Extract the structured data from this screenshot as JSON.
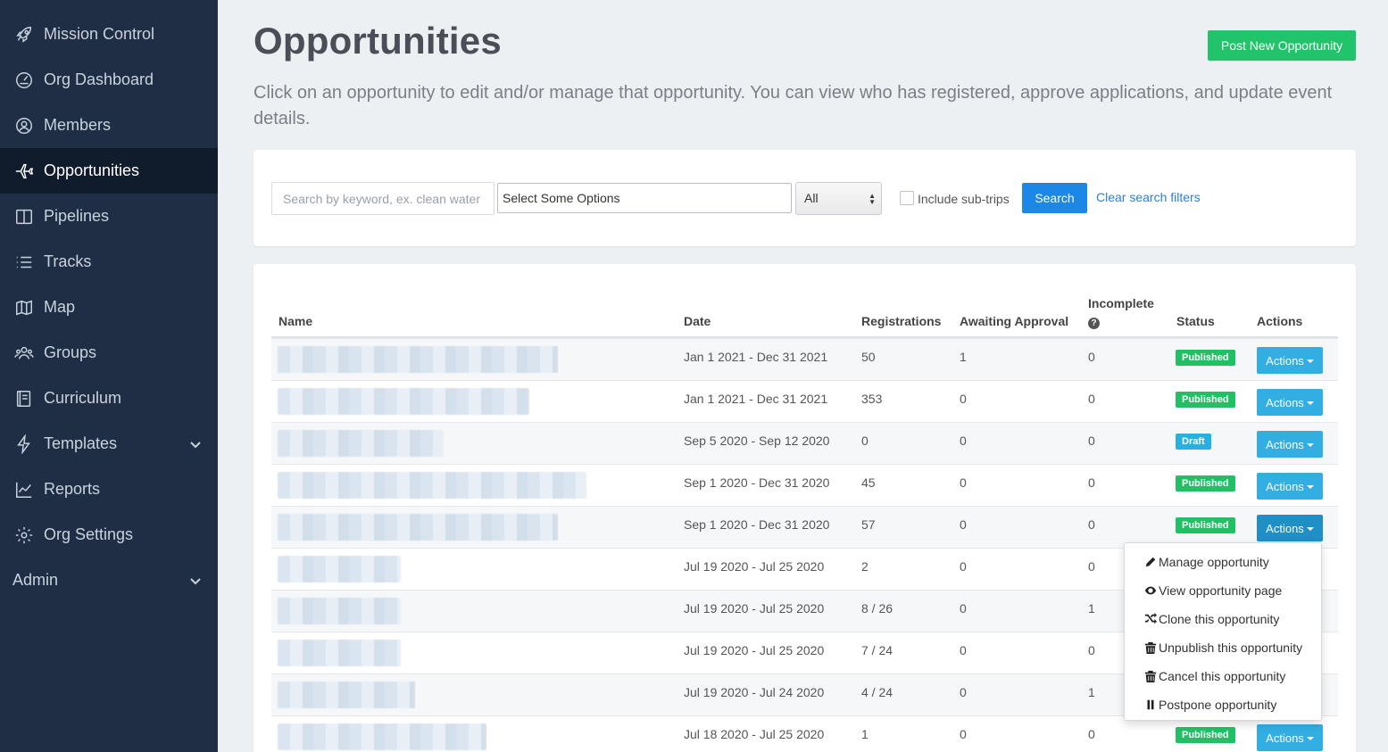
{
  "sidebar": {
    "items": [
      {
        "label": "Mission Control",
        "icon": "rocket-icon"
      },
      {
        "label": "Org Dashboard",
        "icon": "gauge-icon"
      },
      {
        "label": "Members",
        "icon": "user-circle-icon"
      },
      {
        "label": "Opportunities",
        "icon": "plane-icon",
        "active": true
      },
      {
        "label": "Pipelines",
        "icon": "columns-icon"
      },
      {
        "label": "Tracks",
        "icon": "list-icon"
      },
      {
        "label": "Map",
        "icon": "map-icon"
      },
      {
        "label": "Groups",
        "icon": "users-icon"
      },
      {
        "label": "Curriculum",
        "icon": "book-icon"
      },
      {
        "label": "Templates",
        "icon": "bolt-icon",
        "has_chevron": true
      },
      {
        "label": "Reports",
        "icon": "chart-line-icon"
      },
      {
        "label": "Org Settings",
        "icon": "gear-icon"
      }
    ],
    "admin": {
      "label": "Admin",
      "has_chevron": true
    }
  },
  "header": {
    "title": "Opportunities",
    "post_button": "Post New Opportunity",
    "intro": "Click on an opportunity to edit and/or manage that opportunity. You can view who has registered, approve applications, and update event details."
  },
  "filters": {
    "search_placeholder": "Search by keyword, ex. clean water",
    "multi_select": "Select Some Options",
    "status_select": "All",
    "include_subtrips": "Include sub-trips",
    "search_button": "Search",
    "clear_link": "Clear search filters"
  },
  "table": {
    "headers": {
      "name": "Name",
      "date": "Date",
      "registrations": "Registrations",
      "awaiting": "Awaiting Approval",
      "incomplete": "Incomplete",
      "status": "Status",
      "actions": "Actions"
    },
    "rows": [
      {
        "date": "Jan 1 2021 - Dec 31 2021",
        "registrations": "50",
        "awaiting": "1",
        "incomplete": "0",
        "status": "Published",
        "status_type": "published",
        "action": "Actions"
      },
      {
        "date": "Jan 1 2021 - Dec 31 2021",
        "registrations": "353",
        "awaiting": "0",
        "incomplete": "0",
        "status": "Published",
        "status_type": "published",
        "action": "Actions"
      },
      {
        "date": "Sep 5 2020 - Sep 12 2020",
        "registrations": "0",
        "awaiting": "0",
        "incomplete": "0",
        "status": "Draft",
        "status_type": "draft",
        "action": "Actions"
      },
      {
        "date": "Sep 1 2020 - Dec 31 2020",
        "registrations": "45",
        "awaiting": "0",
        "incomplete": "0",
        "status": "Published",
        "status_type": "published",
        "action": "Actions"
      },
      {
        "date": "Sep 1 2020 - Dec 31 2020",
        "registrations": "57",
        "awaiting": "0",
        "incomplete": "0",
        "status": "Published",
        "status_type": "published",
        "action": "Actions"
      },
      {
        "date": "Jul 19 2020 - Jul 25 2020",
        "registrations": "2",
        "awaiting": "0",
        "incomplete": "0",
        "status": "",
        "status_type": "hidden",
        "action": ""
      },
      {
        "date": "Jul 19 2020 - Jul 25 2020",
        "registrations": "8 / 26",
        "awaiting": "0",
        "incomplete": "1",
        "status": "",
        "status_type": "hidden",
        "action": ""
      },
      {
        "date": "Jul 19 2020 - Jul 25 2020",
        "registrations": "7 / 24",
        "awaiting": "0",
        "incomplete": "0",
        "status": "",
        "status_type": "hidden",
        "action": ""
      },
      {
        "date": "Jul 19 2020 - Jul 24 2020",
        "registrations": "4 / 24",
        "awaiting": "0",
        "incomplete": "1",
        "status": "",
        "status_type": "hidden",
        "action": ""
      },
      {
        "date": "Jul 18 2020 - Jul 25 2020",
        "registrations": "1",
        "awaiting": "0",
        "incomplete": "0",
        "status": "Published",
        "status_type": "published",
        "action": "Actions"
      }
    ]
  },
  "dropdown": {
    "items": [
      {
        "label": "Manage opportunity",
        "icon": "pencil-icon"
      },
      {
        "label": "View opportunity page",
        "icon": "eye-icon"
      },
      {
        "label": "Clone this opportunity",
        "icon": "shuffle-icon"
      },
      {
        "label": "Unpublish this opportunity",
        "icon": "trash-icon"
      },
      {
        "label": "Cancel this opportunity",
        "icon": "trash-icon"
      },
      {
        "label": "Postpone opportunity",
        "icon": "pause-icon"
      }
    ]
  },
  "colors": {
    "sidebar_bg": "#1f2d45",
    "sidebar_active": "#101b2c",
    "published": "#22c065",
    "draft": "#2ab0e0",
    "primary": "#1b87e6",
    "post_button": "#21c46a"
  }
}
